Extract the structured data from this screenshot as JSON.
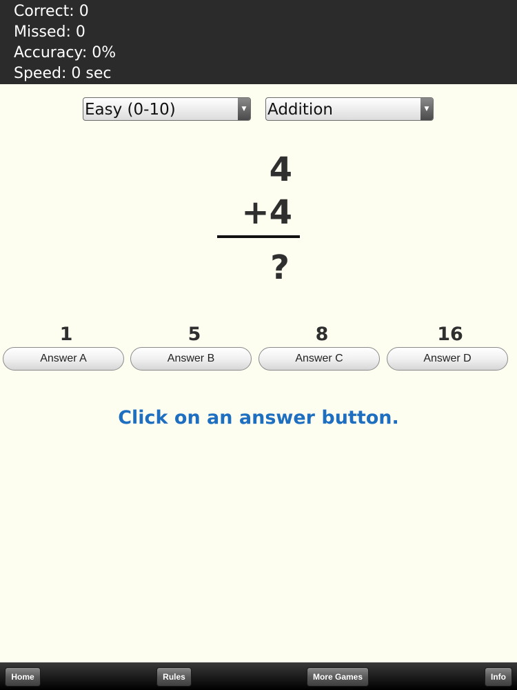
{
  "stats": {
    "correct": "Correct: 0",
    "missed": "Missed: 0",
    "accuracy": "Accuracy: 0%",
    "speed": "Speed: 0 sec"
  },
  "controls": {
    "difficulty": "Easy (0-10)",
    "operation": "Addition"
  },
  "problem": {
    "top": "4",
    "bottom": "+4",
    "result": "?"
  },
  "answers": [
    {
      "value": "1",
      "label": "Answer A"
    },
    {
      "value": "5",
      "label": "Answer B"
    },
    {
      "value": "8",
      "label": "Answer C"
    },
    {
      "value": "16",
      "label": "Answer D"
    }
  ],
  "message": "Click on an answer button.",
  "nav": {
    "home": "Home",
    "rules": "Rules",
    "more_games": "More Games",
    "info": "Info"
  },
  "colors": {
    "background": "#fefef0",
    "stats_bg": "#2b2b2b",
    "message": "#1f6fc0"
  },
  "icons": [
    "dropdown-arrow-icon"
  ]
}
